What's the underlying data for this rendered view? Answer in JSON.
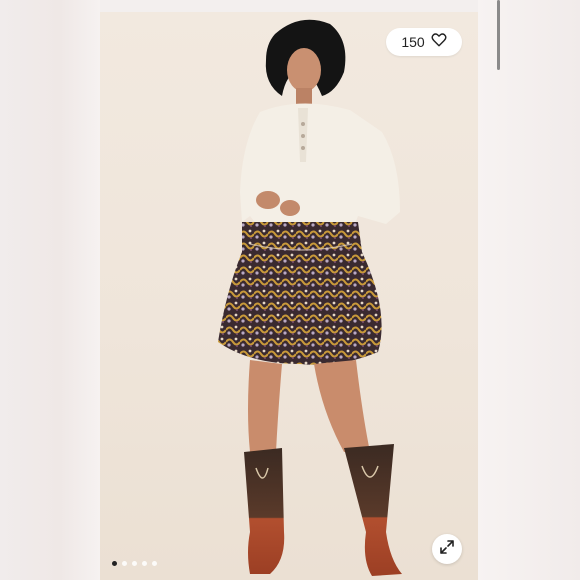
{
  "listing": {
    "likes_count": "150",
    "like_icon": "heart-icon",
    "expand_icon": "expand-icon"
  },
  "carousel": {
    "total_images": 5,
    "active_index": 0
  },
  "colors": {
    "backdrop": "#f1e8de",
    "sweater": "#f4efe6",
    "skirt_base": "#3a2a30",
    "skirt_accent": "#c99a3a",
    "boots": "#b24f2f",
    "boot_shaft": "#3b2a22"
  }
}
